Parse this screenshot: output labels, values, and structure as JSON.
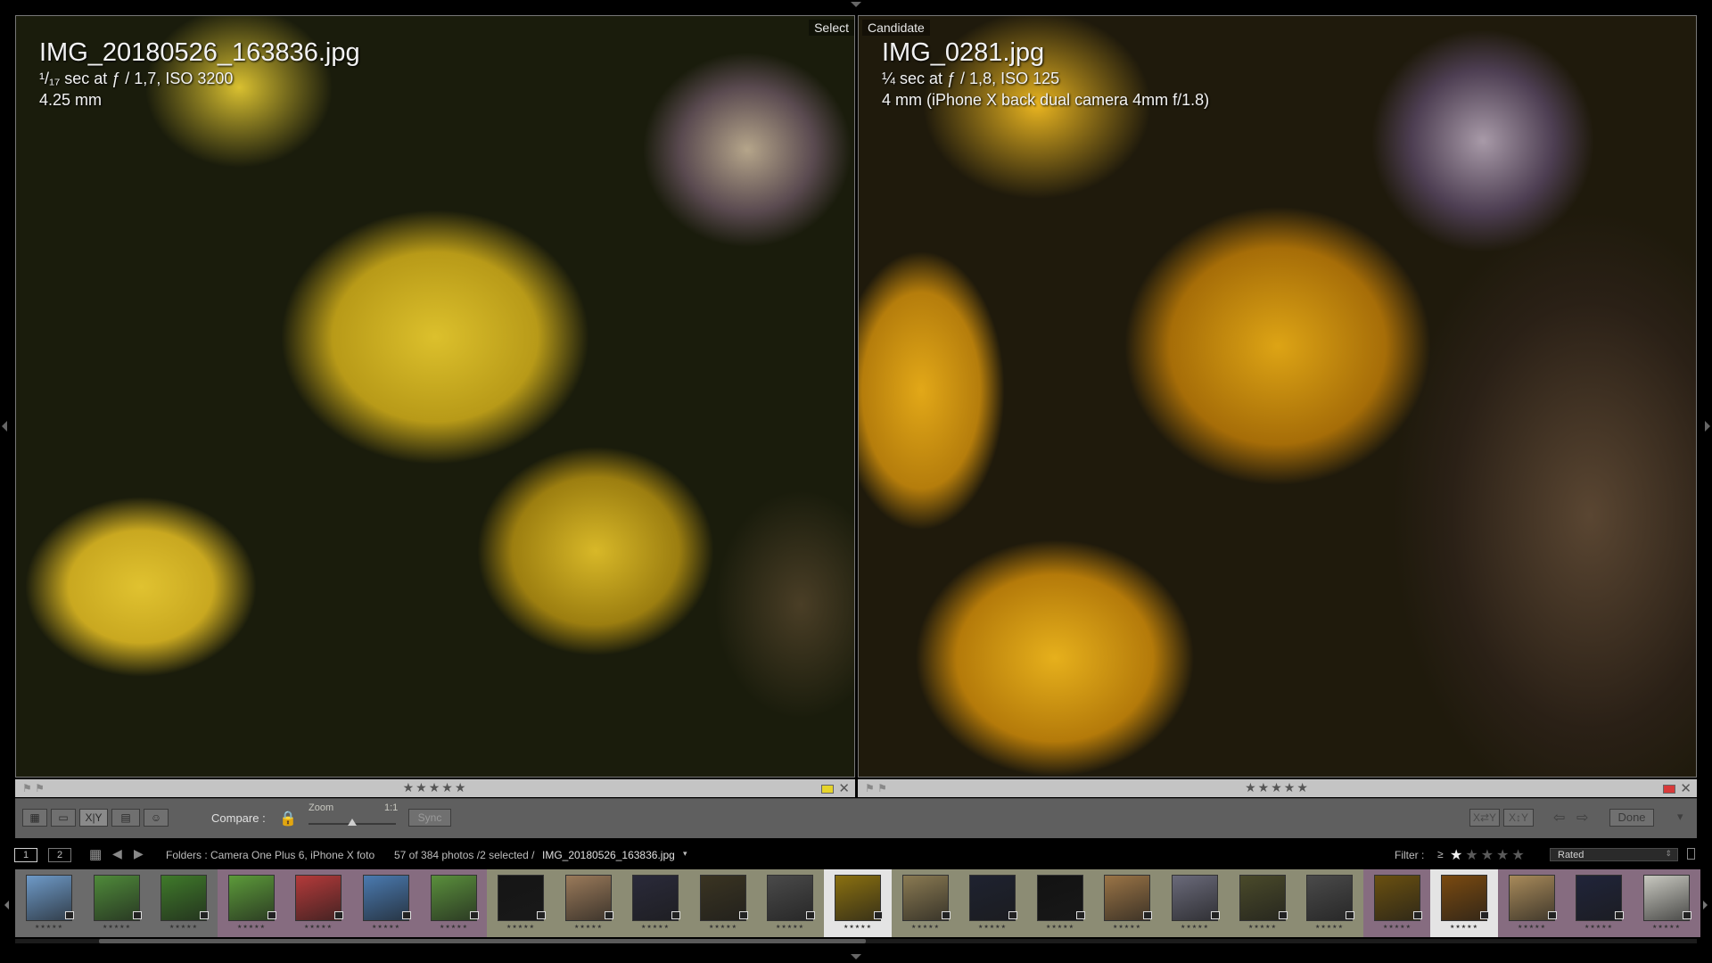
{
  "select_pane": {
    "tag": "Select",
    "filename": "IMG_20180526_163836.jpg",
    "exposure": "¹/₁₇ sec at ƒ / 1,7, ISO 3200",
    "focal": "4.25 mm",
    "rating": "★★★★★",
    "color_label": "#e6d42a"
  },
  "candidate_pane": {
    "tag": "Candidate",
    "filename": "IMG_0281.jpg",
    "exposure": "¼ sec at ƒ / 1,8, ISO 125",
    "focal": "4 mm (iPhone X back dual camera 4mm f/1.8)",
    "rating": "★★★★★",
    "color_label": "#d83a3a"
  },
  "toolbar": {
    "compare_label": "Compare :",
    "zoom_label": "Zoom",
    "zoom_value": "1:1",
    "zoom_level": 0.5,
    "sync_label": "Sync",
    "done_label": "Done"
  },
  "navbar": {
    "monitor1": "1",
    "monitor2": "2",
    "source": "Folders : Camera One Plus 6, iPhone X foto",
    "count": "57 of 384 photos /2 selected /",
    "selected_file": "IMG_20180526_163836.jpg",
    "filter_label": "Filter :",
    "filter_op": "≥",
    "filter_stars": "★★★★★",
    "filter_min_stars": 1,
    "filter_preset": "Rated"
  },
  "filmstrip": {
    "thumbs": [
      {
        "tone": "#6e9ac8",
        "bg": "#6b6b6b",
        "rating": "★★★★★"
      },
      {
        "tone": "#4f8a3a",
        "bg": "#6b6b6b",
        "rating": "★★★★★"
      },
      {
        "tone": "#3f7a2a",
        "bg": "#6b6b6b",
        "rating": "★★★★★"
      },
      {
        "tone": "#5c9a3a",
        "bg": "#866c80",
        "rating": "★★★★★"
      },
      {
        "tone": "#b43a3a",
        "bg": "#866c80",
        "rating": "★★★★★"
      },
      {
        "tone": "#4a7ab0",
        "bg": "#866c80",
        "rating": "★★★★★"
      },
      {
        "tone": "#5a8f3c",
        "bg": "#866c80",
        "rating": "★★★★★"
      },
      {
        "tone": "#151515",
        "bg": "#8c8c74",
        "rating": "★★★★★"
      },
      {
        "tone": "#9a7a5a",
        "bg": "#8c8c74",
        "rating": "★★★★★"
      },
      {
        "tone": "#2a2a3a",
        "bg": "#8c8c74",
        "rating": "★★★★★"
      },
      {
        "tone": "#3a3422",
        "bg": "#8c8c74",
        "rating": "★★★★★"
      },
      {
        "tone": "#4a4a4a",
        "bg": "#8c8c74",
        "rating": "★★★★★"
      },
      {
        "tone": "#8a7010",
        "bg": "#e4e4e4",
        "rating": "★★★★★"
      },
      {
        "tone": "#8a7a52",
        "bg": "#8c8c74",
        "rating": "★★★★★"
      },
      {
        "tone": "#1e2230",
        "bg": "#8c8c74",
        "rating": "★★★★★"
      },
      {
        "tone": "#121212",
        "bg": "#8c8c74",
        "rating": "★★★★★"
      },
      {
        "tone": "#9a7446",
        "bg": "#8c8c74",
        "rating": "★★★★★"
      },
      {
        "tone": "#6a6a7a",
        "bg": "#8c8c74",
        "rating": "★★★★★"
      },
      {
        "tone": "#4a4a2a",
        "bg": "#8c8c74",
        "rating": "★★★★★"
      },
      {
        "tone": "#4a4a4a",
        "bg": "#8c8c74",
        "rating": "★★★★★"
      },
      {
        "tone": "#6a5010",
        "bg": "#866c80",
        "rating": "★★★★★"
      },
      {
        "tone": "#7a4a10",
        "bg": "#e4e4e4",
        "rating": "★★★★★"
      },
      {
        "tone": "#a88a5a",
        "bg": "#866c80",
        "rating": "★★★★★"
      },
      {
        "tone": "#20243a",
        "bg": "#866c80",
        "rating": "★★★★★"
      },
      {
        "tone": "#c8c8c0",
        "bg": "#866c80",
        "rating": "★★★★★"
      }
    ]
  }
}
